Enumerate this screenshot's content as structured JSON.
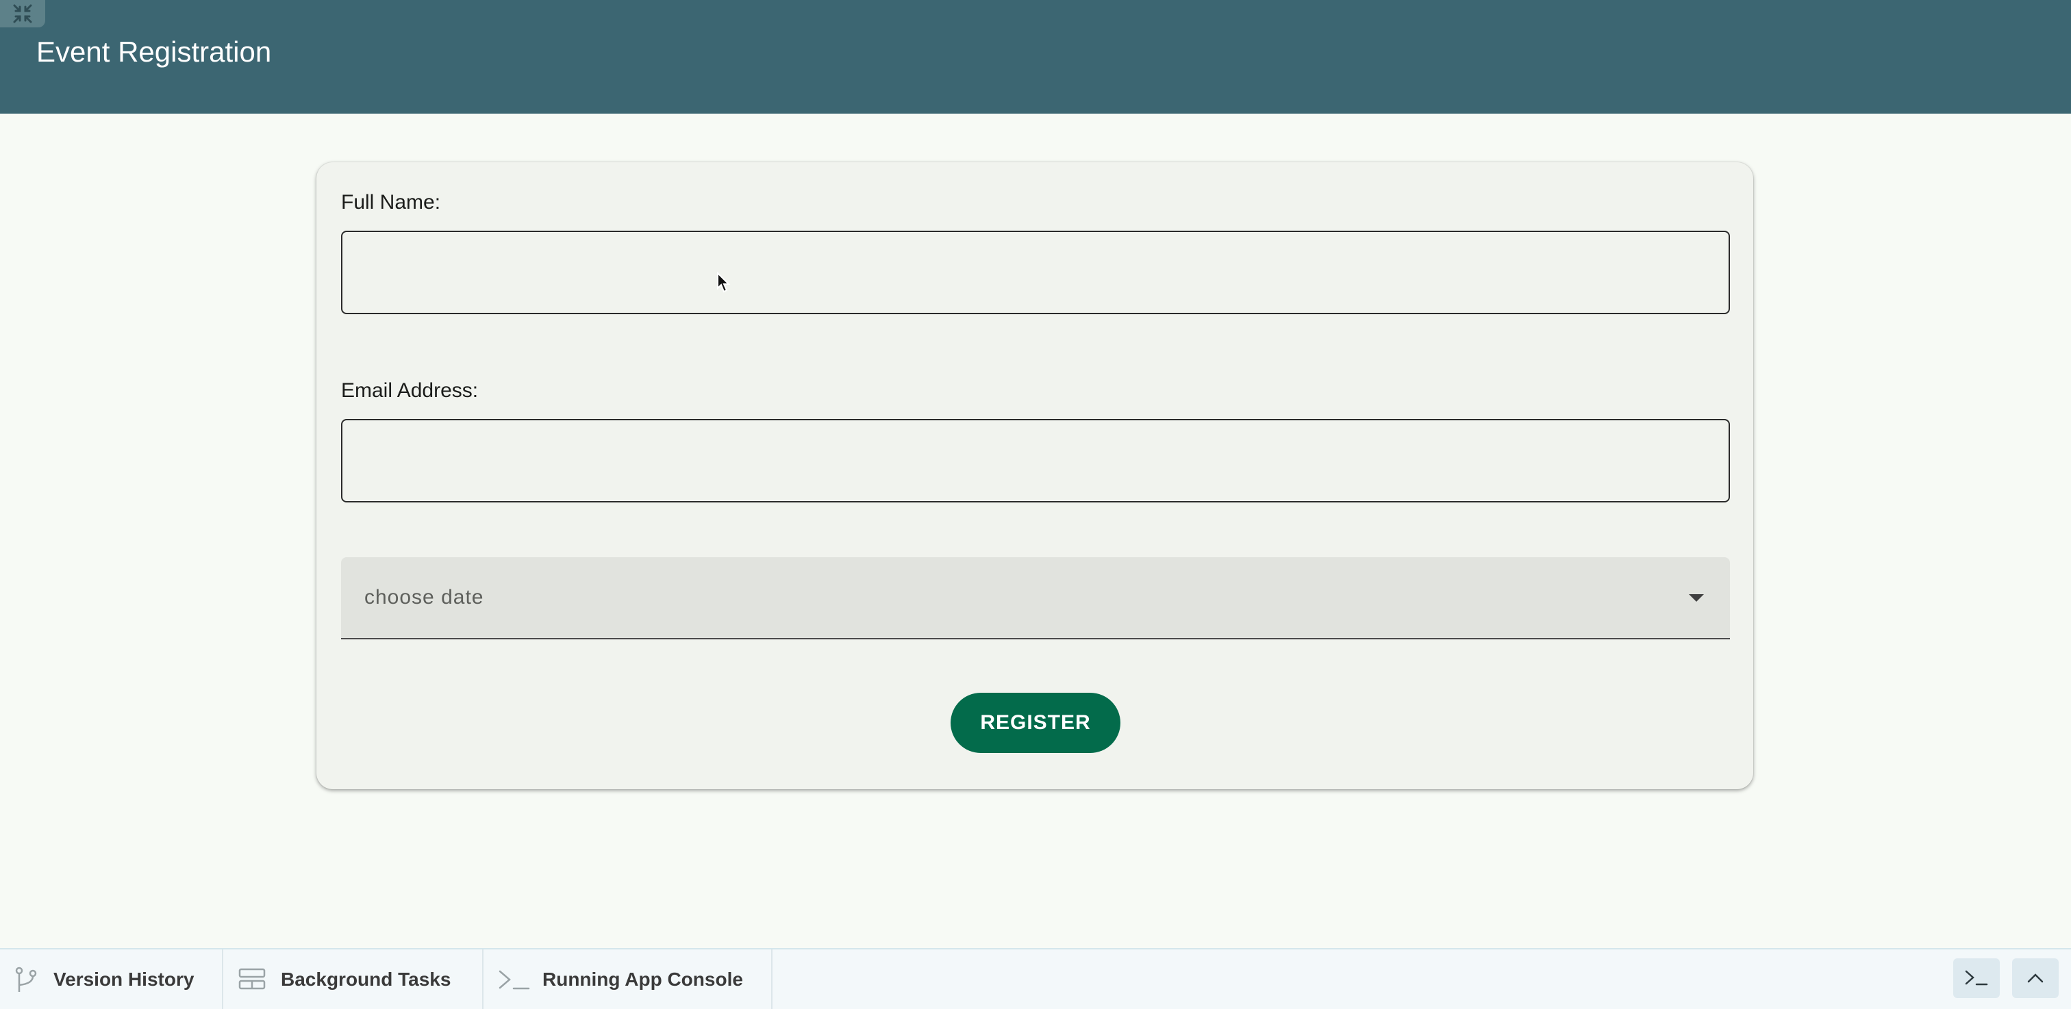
{
  "header": {
    "title": "Event Registration",
    "collapse_icon": "collapse-arrows-icon",
    "background_color": "#3c6672"
  },
  "form": {
    "full_name_label": "Full Name:",
    "full_name_value": "",
    "email_label": "Email Address:",
    "email_value": "",
    "date_select": {
      "placeholder": "choose date",
      "icon": "caret-down-icon"
    },
    "register_label": "REGISTER",
    "accent_color": "#036b4b"
  },
  "bottom_panel": {
    "tabs": [
      {
        "label": "Version History",
        "icon": "branch-icon"
      },
      {
        "label": "Background Tasks",
        "icon": "tasks-icon"
      },
      {
        "label": "Running App Console",
        "icon": "terminal-icon"
      }
    ],
    "console_button_icon": "terminal-icon",
    "expand_button_icon": "chevron-up-icon"
  }
}
